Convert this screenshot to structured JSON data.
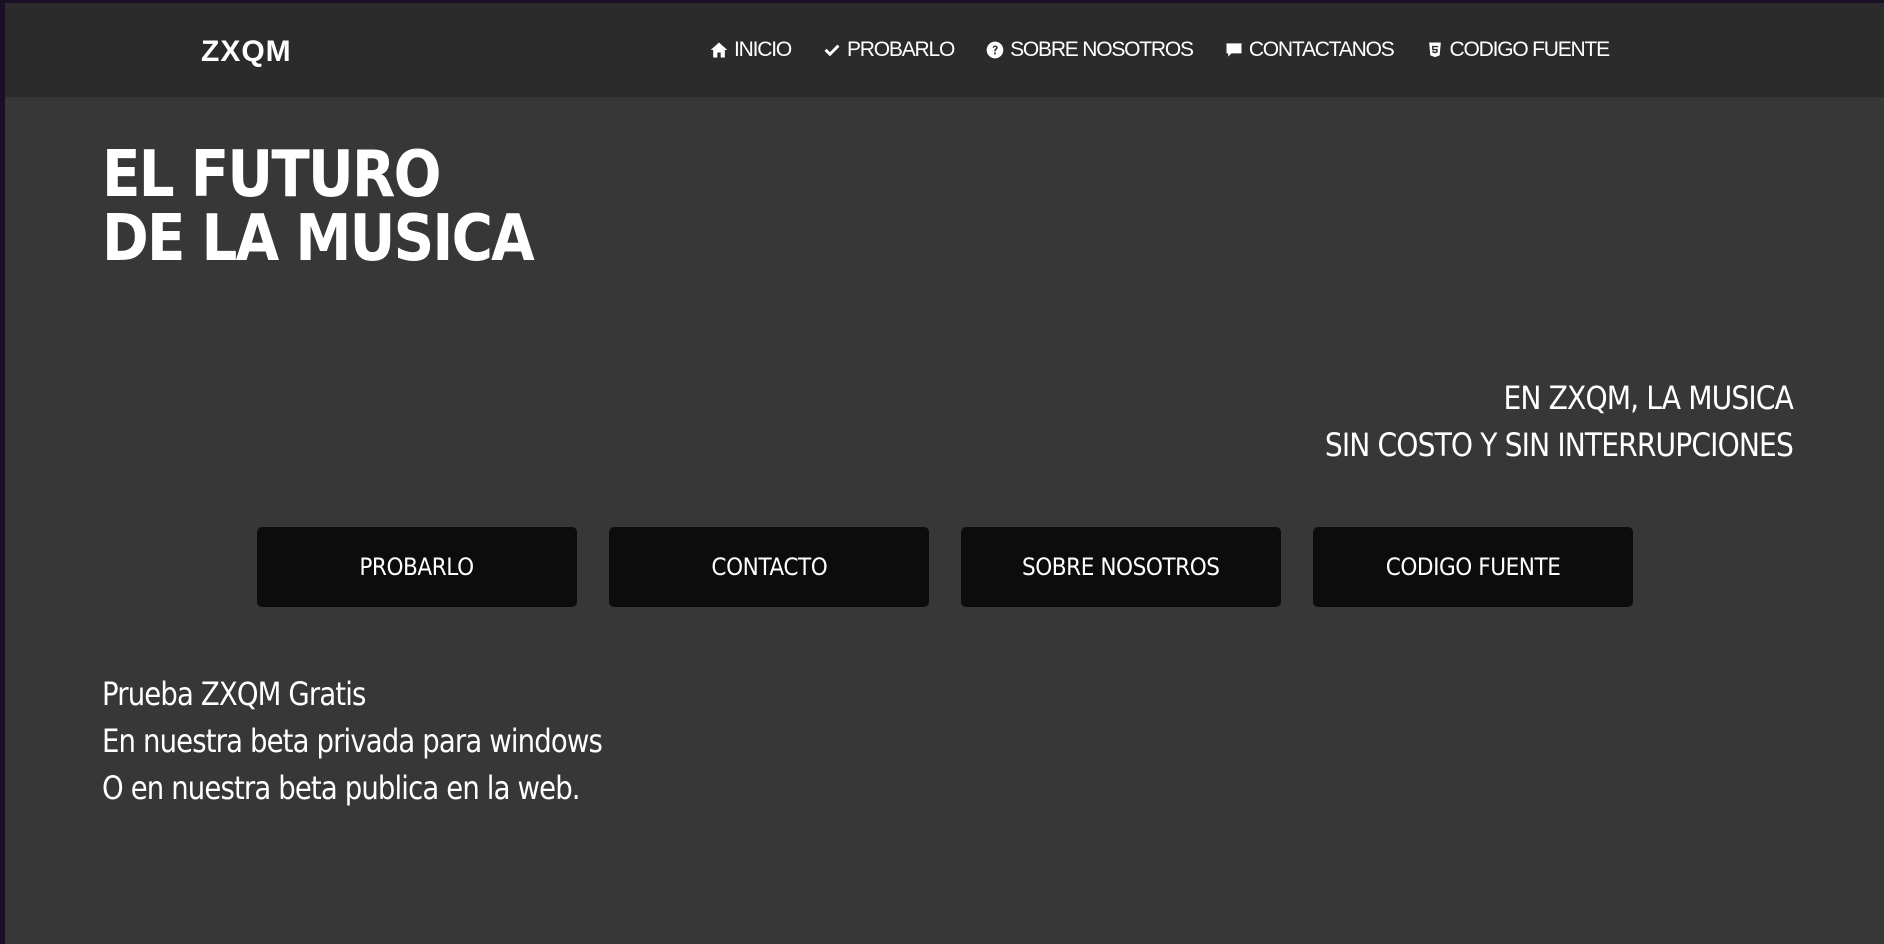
{
  "brand": "ZXQM",
  "nav": [
    {
      "label": "INICIO",
      "icon": "home-icon"
    },
    {
      "label": "PROBARLO",
      "icon": "check-icon"
    },
    {
      "label": "SOBRE NOSOTROS",
      "icon": "question-circle-icon"
    },
    {
      "label": "CONTACTANOS",
      "icon": "comment-icon"
    },
    {
      "label": "CODIGO FUENTE",
      "icon": "html5-icon"
    }
  ],
  "hero": {
    "title_line1": "EL FUTURO",
    "title_line2": "DE LA MUSICA"
  },
  "tagline": {
    "line1": "EN ZXQM, LA MUSICA",
    "line2": "SIN COSTO Y SIN INTERRUPCIONES"
  },
  "buttons": [
    {
      "label": "PROBARLO"
    },
    {
      "label": "CONTACTO"
    },
    {
      "label": "SOBRE NOSOTROS"
    },
    {
      "label": "CODIGO FUENTE"
    }
  ],
  "promo": {
    "line1": "Prueba ZXQM Gratis",
    "line2": "En nuestra beta privada para windows",
    "line3": "O en nuestra beta publica en la web."
  },
  "colors": {
    "page_bg": "#373737",
    "topbar_bg": "#2b2b2b",
    "button_bg": "#0c0c0c",
    "text": "#ffffff"
  }
}
